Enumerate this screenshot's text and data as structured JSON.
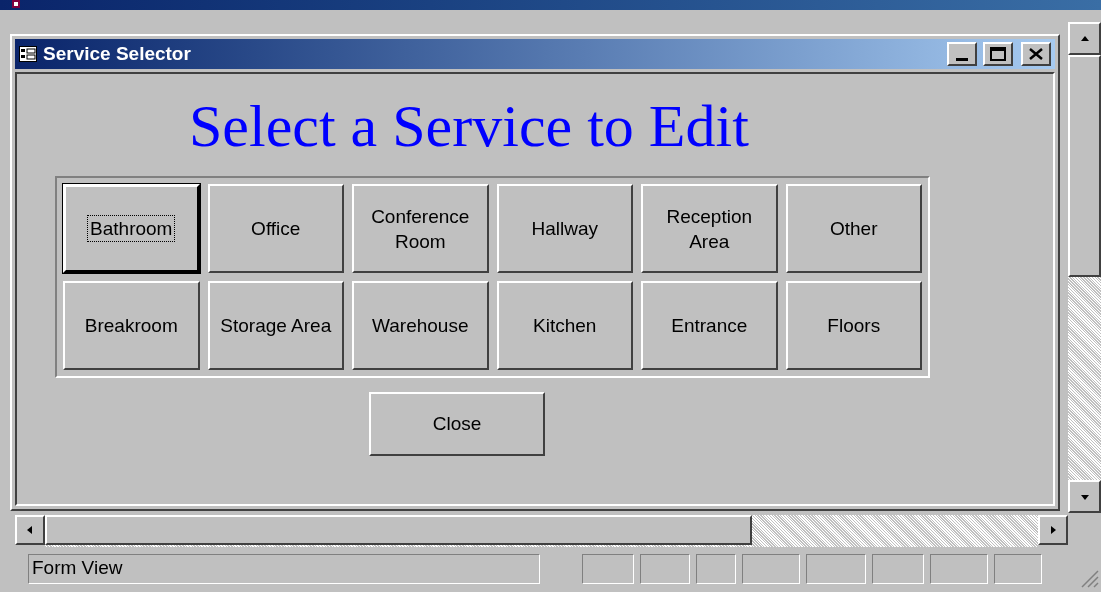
{
  "window": {
    "title": "Service Selector"
  },
  "form": {
    "heading": "Select a Service to Edit",
    "services": [
      {
        "label": "Bathroom",
        "focused": true
      },
      {
        "label": "Office",
        "focused": false
      },
      {
        "label": "Conference Room",
        "focused": false
      },
      {
        "label": "Hallway",
        "focused": false
      },
      {
        "label": "Reception Area",
        "focused": false
      },
      {
        "label": "Other",
        "focused": false
      },
      {
        "label": "Breakroom",
        "focused": false
      },
      {
        "label": "Storage Area",
        "focused": false
      },
      {
        "label": "Warehouse",
        "focused": false
      },
      {
        "label": "Kitchen",
        "focused": false
      },
      {
        "label": "Entrance",
        "focused": false
      },
      {
        "label": "Floors",
        "focused": false
      }
    ],
    "close_button": "Close"
  },
  "status_bar": {
    "text": "Form View"
  }
}
